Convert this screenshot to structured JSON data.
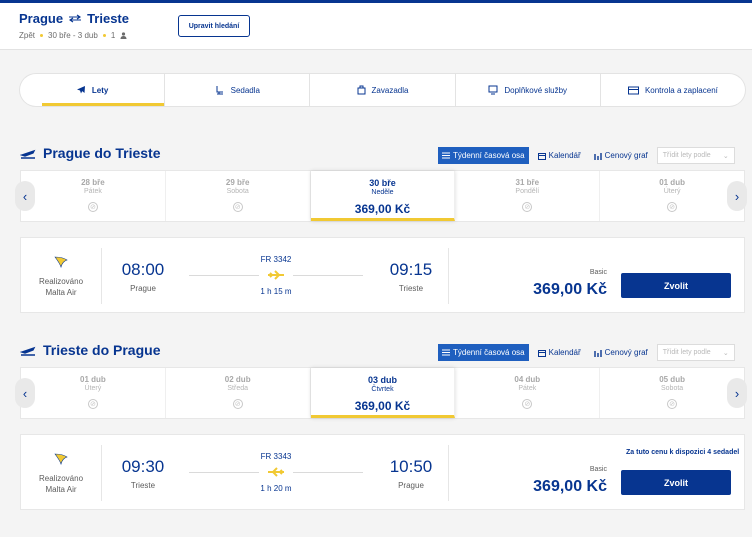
{
  "header": {
    "origin": "Prague",
    "destination": "Trieste",
    "trip_type": "Zpět",
    "dates": "30 bře - 3 dub",
    "passengers": "1",
    "edit_label": "Upravit hledání"
  },
  "steps": [
    {
      "label": "Lety",
      "icon": "plane-icon"
    },
    {
      "label": "Sedadla",
      "icon": "seat-icon"
    },
    {
      "label": "Zavazadla",
      "icon": "luggage-icon"
    },
    {
      "label": "Doplňkové služby",
      "icon": "monitor-icon"
    },
    {
      "label": "Kontrola a zaplacení",
      "icon": "card-icon"
    }
  ],
  "view_bar": {
    "timeline": "Týdenní časová osa",
    "calendar": "Kalendář",
    "price_chart": "Cenový graf",
    "sort": "Třídit lety podle"
  },
  "outbound": {
    "title": "Prague do Trieste",
    "dates": [
      {
        "date": "28 bře",
        "weekday": "Pátek"
      },
      {
        "date": "29 bře",
        "weekday": "Sobota"
      },
      {
        "date": "30 bře",
        "weekday": "Neděle",
        "price": "369,00 Kč"
      },
      {
        "date": "31 bře",
        "weekday": "Pondělí"
      },
      {
        "date": "01 dub",
        "weekday": "Úterý"
      }
    ],
    "flight": {
      "operator": "Realizováno Malta Air",
      "dep_time": "08:00",
      "dep_place": "Prague",
      "arr_time": "09:15",
      "arr_place": "Trieste",
      "flight_no": "FR 3342",
      "duration": "1 h 15 m",
      "fare": "Basic",
      "price": "369,00 Kč",
      "button": "Zvolit"
    }
  },
  "inbound": {
    "title": "Trieste do Prague",
    "dates": [
      {
        "date": "01 dub",
        "weekday": "Úterý"
      },
      {
        "date": "02 dub",
        "weekday": "Středa"
      },
      {
        "date": "03 dub",
        "weekday": "Čtvrtek",
        "price": "369,00 Kč"
      },
      {
        "date": "04 dub",
        "weekday": "Pátek"
      },
      {
        "date": "05 dub",
        "weekday": "Sobota"
      }
    ],
    "flight": {
      "operator": "Realizováno Malta Air",
      "dep_time": "09:30",
      "dep_place": "Trieste",
      "arr_time": "10:50",
      "arr_place": "Prague",
      "flight_no": "FR 3343",
      "duration": "1 h 20 m",
      "fare": "Basic",
      "price": "369,00 Kč",
      "button": "Zvolit",
      "seats_note": "Za tuto cenu k dispozici 4 sedadel"
    }
  },
  "colors": {
    "brand": "#073590",
    "accent": "#f1c933",
    "active_tab": "#1f5fbf"
  }
}
